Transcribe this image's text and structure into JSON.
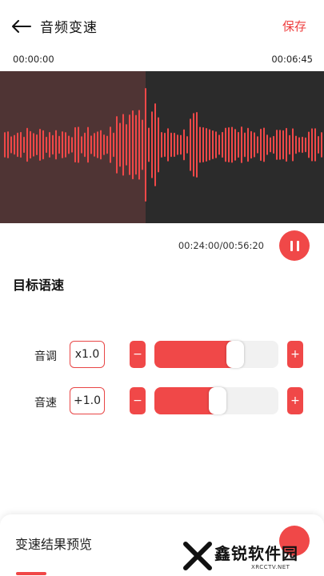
{
  "header": {
    "back_icon": "arrow-left-icon",
    "title": "音频变速",
    "save_label": "保存"
  },
  "timeline": {
    "start": "00:00:00",
    "end": "00:06:45",
    "played_fraction": 0.45
  },
  "waveform": {
    "played_color": "#4f3434",
    "background_color": "#2b2b2b",
    "wave_color": "#f04848"
  },
  "player": {
    "time": "00:24:00/00:56:20",
    "pause_icon": "pause-icon"
  },
  "section": {
    "title": "目标语速"
  },
  "controls": [
    {
      "label": "音调",
      "value": "x1.0",
      "minus": "−",
      "plus": "+",
      "fraction": 0.62
    },
    {
      "label": "音速",
      "value": "+1.0",
      "minus": "−",
      "plus": "+",
      "fraction": 0.45
    }
  ],
  "preview": {
    "title": "变速结果预览"
  },
  "watermark": {
    "text": "鑫锐软件园",
    "sub": "XRCCTV.NET"
  },
  "colors": {
    "accent": "#f04848"
  }
}
